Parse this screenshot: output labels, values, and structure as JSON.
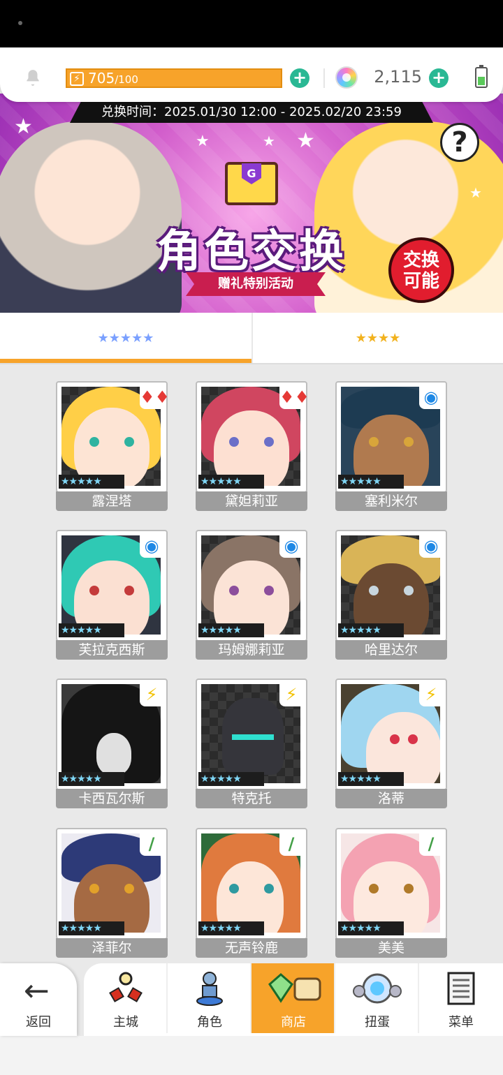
{
  "topbar": {
    "stamina_current": "705",
    "stamina_max": "/100",
    "gems": "2,115",
    "stamina_icon": "lightning-icon",
    "plus_icon": "plus-icon"
  },
  "banner": {
    "exchange_time": "兑换时间：2025.01/30 12:00 - 2025.02/20 23:59",
    "title": "角色交换",
    "subtitle": "赠礼特别活动",
    "badge_line1": "交换",
    "badge_line2": "可能",
    "help": "?"
  },
  "tabs": [
    {
      "label": "★★★★★",
      "selected": true
    },
    {
      "label": "★★★★",
      "selected": false
    }
  ],
  "characters": [
    {
      "name": "露涅塔",
      "stars": "★★★★★",
      "element": "♦♦",
      "element_icon": "fire-element-icon"
    },
    {
      "name": "黛妲莉亚",
      "stars": "★★★★★",
      "element": "♦♦",
      "element_icon": "fire-element-icon"
    },
    {
      "name": "塞利米尔",
      "stars": "★★★★★",
      "element": "◉",
      "element_icon": "water-element-icon"
    },
    {
      "name": "芙拉克西斯",
      "stars": "★★★★★",
      "element": "◉",
      "element_icon": "water-element-icon"
    },
    {
      "name": "玛姆娜莉亚",
      "stars": "★★★★★",
      "element": "◉",
      "element_icon": "water-element-icon"
    },
    {
      "name": "哈里达尔",
      "stars": "★★★★★",
      "element": "◉",
      "element_icon": "water-element-icon"
    },
    {
      "name": "卡西瓦尔斯",
      "stars": "★★★★★",
      "element": "⚡",
      "element_icon": "lightning-element-icon"
    },
    {
      "name": "特克托",
      "stars": "★★★★★",
      "element": "⚡",
      "element_icon": "lightning-element-icon"
    },
    {
      "name": "洛蒂",
      "stars": "★★★★★",
      "element": "⚡",
      "element_icon": "lightning-element-icon"
    },
    {
      "name": "泽菲尔",
      "stars": "★★★★★",
      "element": "/",
      "element_icon": "wind-element-icon"
    },
    {
      "name": "无声铃鹿",
      "stars": "★★★★★",
      "element": "/",
      "element_icon": "wind-element-icon"
    },
    {
      "name": "美美",
      "stars": "★★★★★",
      "element": "/",
      "element_icon": "wind-element-icon"
    }
  ],
  "nav": {
    "back": "返回",
    "items": [
      {
        "label": "主城",
        "icon": "castle-icon"
      },
      {
        "label": "角色",
        "icon": "character-icon"
      },
      {
        "label": "商店",
        "icon": "shop-icon",
        "active": true
      },
      {
        "label": "扭蛋",
        "icon": "gacha-icon"
      },
      {
        "label": "菜单",
        "icon": "menu-icon"
      }
    ]
  },
  "colors": {
    "accent": "#f7a32a",
    "plus": "#2ab894",
    "fire": "#e53935",
    "water": "#1e88e5",
    "lightning": "#f2c200",
    "wind": "#43a047"
  }
}
